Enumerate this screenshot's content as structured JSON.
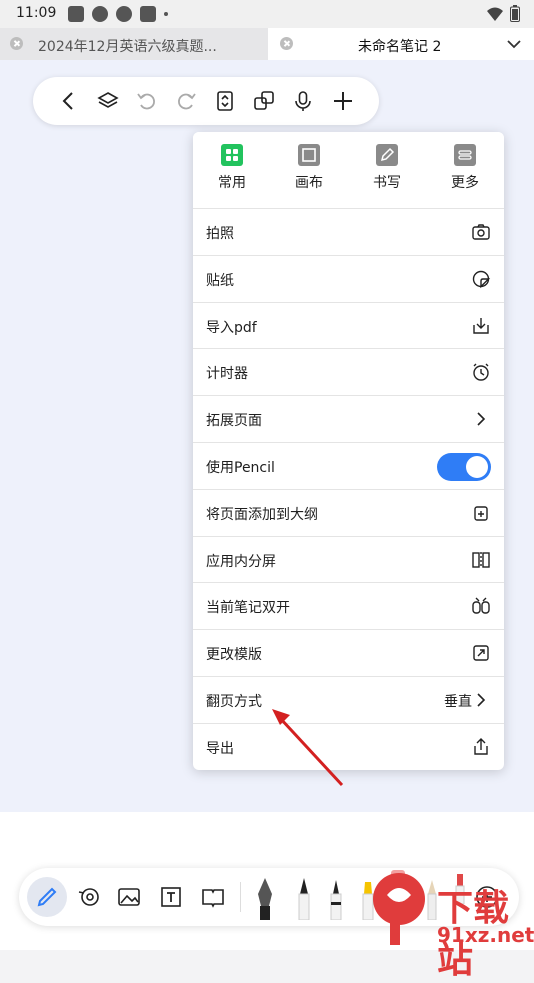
{
  "status_bar": {
    "time": "11:09"
  },
  "tabs": [
    {
      "title": "2024年12月英语六级真题...",
      "active": false
    },
    {
      "title": "未命名笔记 2",
      "active": true
    }
  ],
  "menu": {
    "categories": [
      {
        "label": "常用",
        "icon": "grid-icon",
        "active": true
      },
      {
        "label": "画布",
        "icon": "canvas-icon",
        "active": false
      },
      {
        "label": "书写",
        "icon": "pen-icon",
        "active": false
      },
      {
        "label": "更多",
        "icon": "more-icon",
        "active": false
      }
    ],
    "items": [
      {
        "label": "拍照",
        "icon": "camera-icon"
      },
      {
        "label": "贴纸",
        "icon": "sticker-icon"
      },
      {
        "label": "导入pdf",
        "icon": "import-icon"
      },
      {
        "label": "计时器",
        "icon": "alarm-icon"
      },
      {
        "label": "拓展页面",
        "icon": "chevron-right-icon"
      },
      {
        "label": "使用Pencil",
        "toggle": true
      },
      {
        "label": "将页面添加到大纲",
        "icon": "outline-add-icon"
      },
      {
        "label": "应用内分屏",
        "icon": "split-screen-icon"
      },
      {
        "label": "当前笔记双开",
        "icon": "dual-open-icon"
      },
      {
        "label": "更改模版",
        "icon": "template-icon"
      },
      {
        "label": "翻页方式",
        "value": "垂直",
        "icon": "chevron-right-icon"
      },
      {
        "label": "导出",
        "icon": "share-icon"
      }
    ]
  },
  "watermark": {
    "site": "下载站",
    "url": "91xz.net"
  },
  "colors": {
    "accent": "#2f7df6",
    "active_category": "#22c35e",
    "canvas_bg": "#eef1fb"
  }
}
